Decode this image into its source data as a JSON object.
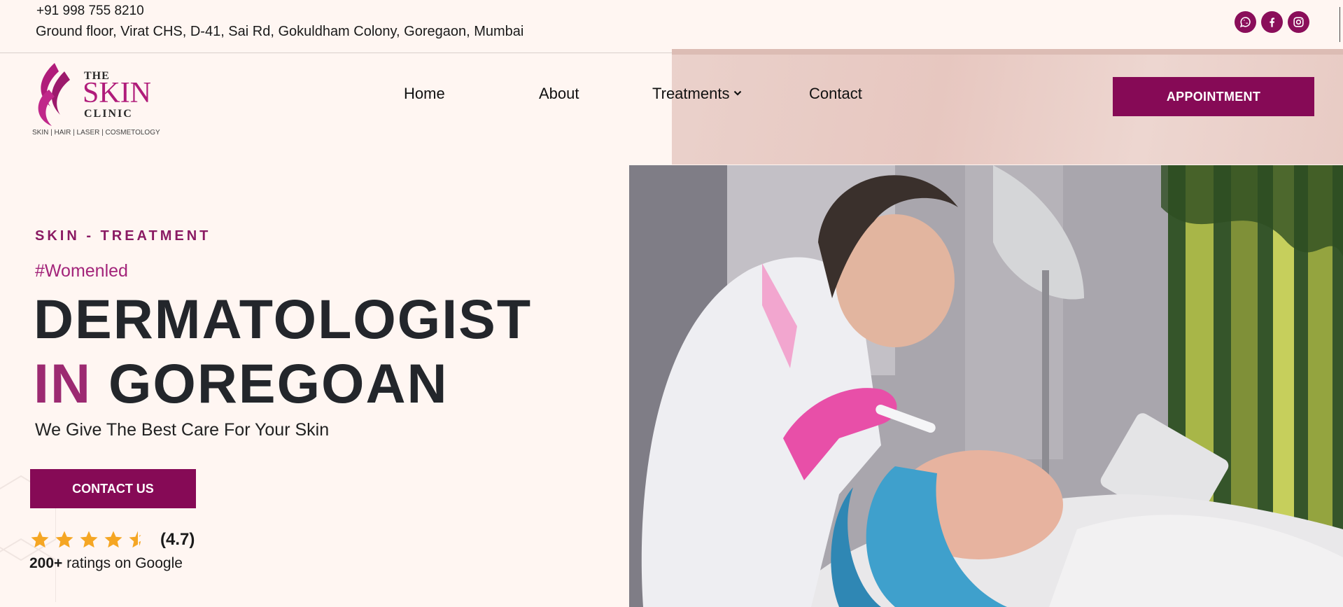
{
  "topbar": {
    "phone": "+91 998 755 8210",
    "address": "Ground floor, Virat CHS, D-41, Sai Rd, Gokuldham Colony, Goregaon, Mumbai",
    "socials": [
      "whatsapp-icon",
      "facebook-icon",
      "instagram-icon"
    ]
  },
  "logo": {
    "the": "THE",
    "skin": "SKIN",
    "clinic": "CLINIC",
    "tagline": "SKIN | HAIR | LASER | COSMETOLOGY"
  },
  "nav": {
    "home": "Home",
    "about": "About",
    "treatments": "Treatments",
    "contact": "Contact",
    "appointment": "APPOINTMENT"
  },
  "hero": {
    "eyebrow": "SKIN - TREATMENT",
    "hashtag": "#Womenled",
    "title_line1": "DERMATOLOGIST",
    "title_in": "IN",
    "title_place": "GOREGOAN",
    "subtitle": "We Give The Best Care For Your Skin",
    "cta": "CONTACT US",
    "rating_value": "(4.7)",
    "rating_stars": 4.5,
    "ratings_count": "200+",
    "ratings_text": " ratings on Google"
  },
  "colors": {
    "brand": "#860a56",
    "accent": "#9c2a71",
    "star": "#f5a623",
    "background": "#fff6f2"
  }
}
